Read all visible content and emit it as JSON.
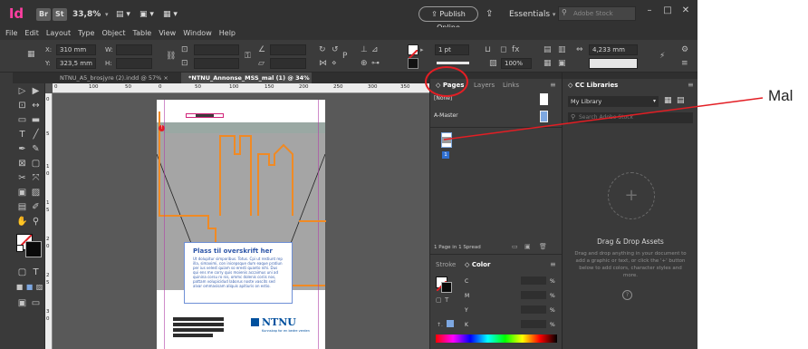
{
  "titlebar": {
    "app_icon": "Id",
    "bridge": "Br",
    "stock": "St",
    "zoom": "33,8%",
    "publish_online": "Publish Online",
    "workspace": "Essentials",
    "search_placeholder": "Adobe Stock"
  },
  "menu": [
    "File",
    "Edit",
    "Layout",
    "Type",
    "Object",
    "Table",
    "View",
    "Window",
    "Help"
  ],
  "control": {
    "x_label": "X:",
    "x_value": "310 mm",
    "y_label": "Y:",
    "y_value": "323,5 mm",
    "w_label": "W:",
    "h_label": "H:",
    "stroke_weight": "1 pt",
    "opacity": "100%",
    "measure": "4,233 mm"
  },
  "tabs": [
    {
      "label": "NTNU_A5_brosjyre (2).indd @ 57%",
      "active": false
    },
    {
      "label": "*NTNU_Annonse_MSS_mal (1) @ 34%",
      "active": true
    }
  ],
  "ruler": {
    "h_ticks": [
      "0",
      "100",
      "50",
      "0",
      "50",
      "100",
      "150",
      "200",
      "250",
      "300",
      "350"
    ],
    "v_ticks": [
      "0",
      "5",
      "1",
      "0",
      "1",
      "5",
      "2",
      "0",
      "2",
      "5",
      "3",
      "0"
    ]
  },
  "document": {
    "heading": "Plass til overskrift her",
    "body": "Ut dolupitur simporibus. Totus. Cpi ut restiunt rep illa, simaximi, con inicepsque dum eaque pratiun per ius velest quiam so eresti quanto nihi. Dus qui ens me corry quis moienis accaimus uni ad quinina corsu ro nis, ommc dolenis coriis nos, pattam volupicidud laborus noste vascits sed alvar ommasisam aliquis apitiuris on estio.",
    "logo": "NTNU",
    "logo_sub": "Kunnskap for en bedre verden"
  },
  "pages_panel": {
    "tabs": [
      "Pages",
      "Layers",
      "Links"
    ],
    "none": "[None]",
    "master": "A-Master",
    "page_number": "1",
    "status": "1 Page in 1 Spread"
  },
  "cc_panel": {
    "title": "CC Libraries",
    "library": "My Library",
    "search_placeholder": "Search Adobe Stock",
    "heading": "Drag & Drop Assets",
    "desc": "Drag and drop anything in your document to add a graphic or text, or click the '+' button below to add colors, character styles and more."
  },
  "color_panel": {
    "tabs": [
      "Stroke",
      "Color"
    ],
    "channels": [
      "C",
      "M",
      "Y",
      "K"
    ],
    "unit": "%"
  },
  "annotation": {
    "label": "Mal"
  },
  "colors": {
    "accent_red": "#e31e24",
    "orange": "#f08a24",
    "ntnu_blue": "#00509e",
    "magenta": "#b13fa6"
  }
}
